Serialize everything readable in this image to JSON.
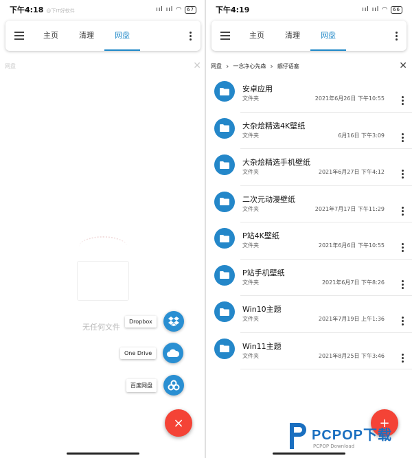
{
  "left": {
    "status": {
      "time": "下午4:18",
      "watermark": "@下IT好软件",
      "signal": "ııl ııl",
      "battery": "67"
    },
    "tabs": [
      "主页",
      "清理",
      "网盘"
    ],
    "breadcrumb": "网盘",
    "empty_text": "无任何文件",
    "fab_options": [
      "Dropbox",
      "One Drive",
      "百度网盘"
    ],
    "fab_close": "×"
  },
  "right": {
    "status": {
      "time": "下午4:19",
      "signal": "ııl ııl",
      "battery": "66"
    },
    "tabs": [
      "主页",
      "清理",
      "网盘"
    ],
    "breadcrumb": [
      "网盘",
      "一念净心先森",
      "靓仔语塞"
    ],
    "items": [
      {
        "name": "安卓应用",
        "type": "文件夹",
        "date": "2021年6月26日 下午10:55"
      },
      {
        "name": "大杂烩精选4K壁纸",
        "type": "文件夹",
        "date": "6月16日 下午3:09"
      },
      {
        "name": "大杂烩精选手机壁纸",
        "type": "文件夹",
        "date": "2021年6月27日 下午4:12"
      },
      {
        "name": "二次元动漫壁纸",
        "type": "文件夹",
        "date": "2021年7月17日 下午11:29"
      },
      {
        "name": "P站4K壁纸",
        "type": "文件夹",
        "date": "2021年6月6日 下午10:55"
      },
      {
        "name": "P站手机壁纸",
        "type": "文件夹",
        "date": "2021年6月7日 下午8:26"
      },
      {
        "name": "Win10主题",
        "type": "文件夹",
        "date": "2021年7月19日 上午1:36"
      },
      {
        "name": "Win11主题",
        "type": "文件夹",
        "date": "2021年8月25日 下午3:46"
      }
    ],
    "fab": "+"
  },
  "watermark_logo": {
    "main": "PCPOP下载",
    "sub": "PCPOP Download"
  },
  "colors": {
    "accent": "#1e88c8",
    "folder": "#2487c9",
    "fab": "#f44336"
  }
}
